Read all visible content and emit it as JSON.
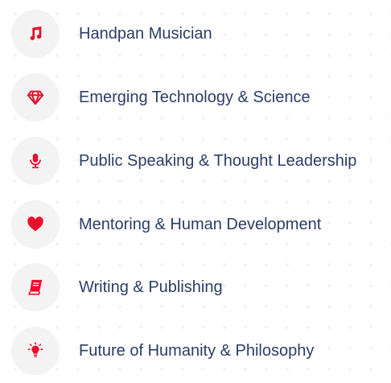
{
  "accent_color": "#e8112d",
  "items": [
    {
      "label": "Handpan Musician",
      "icon": "music-note-icon"
    },
    {
      "label": "Emerging Technology & Science",
      "icon": "diamond-icon"
    },
    {
      "label": "Public Speaking & Thought Leadership",
      "icon": "microphone-icon"
    },
    {
      "label": "Mentoring & Human Development",
      "icon": "heart-icon"
    },
    {
      "label": "Writing & Publishing",
      "icon": "book-icon"
    },
    {
      "label": "Future of Humanity & Philosophy",
      "icon": "lightbulb-icon"
    }
  ]
}
